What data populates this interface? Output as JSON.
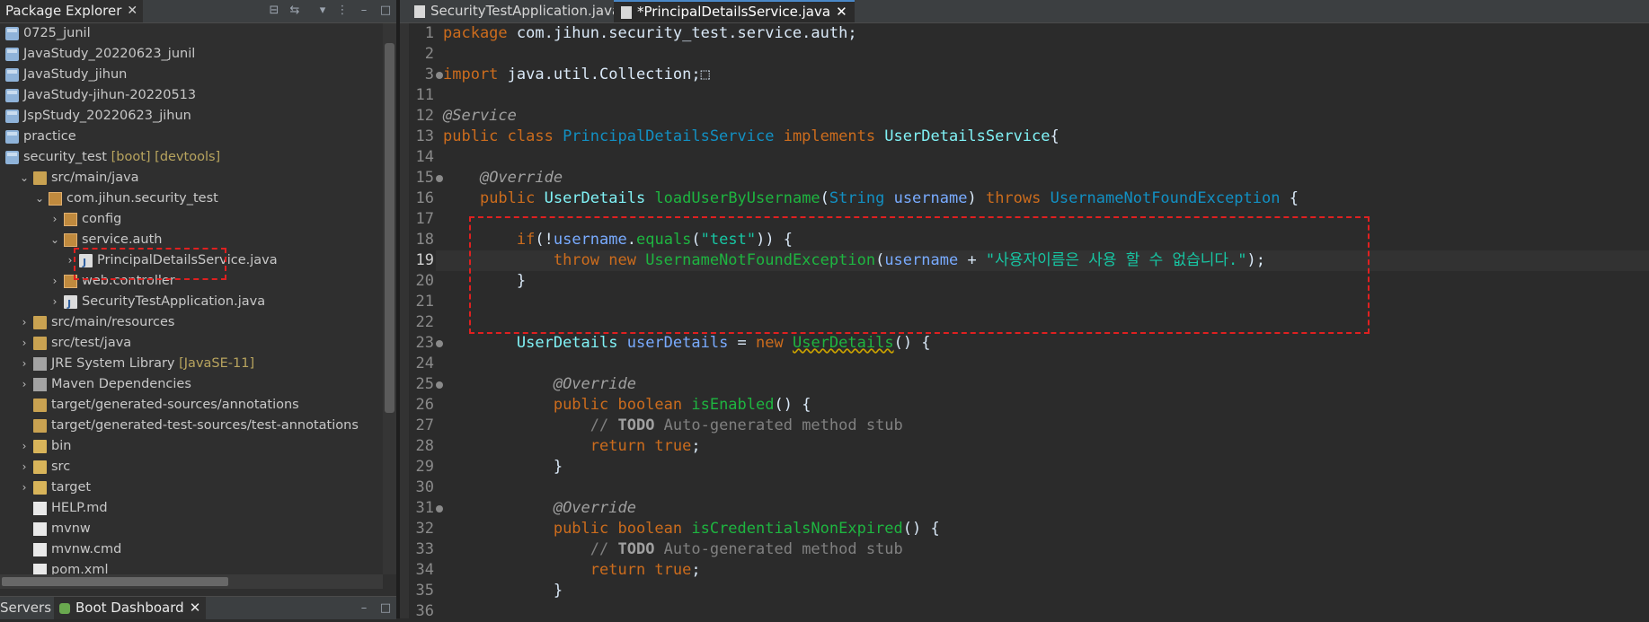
{
  "package_explorer": {
    "title": "Package Explorer",
    "close_glyph": "✕",
    "toolbar_icons": [
      "collapse-all-icon",
      "link-with-editor-icon",
      "filter-icon",
      "view-menu-icon",
      "minimize-icon",
      "maximize-icon"
    ],
    "tree": [
      {
        "label": "0725_junil",
        "icon": "project-icon",
        "depth": 0,
        "twisty": ""
      },
      {
        "label": "JavaStudy_20220623_junil",
        "icon": "project-icon",
        "depth": 0,
        "twisty": ""
      },
      {
        "label": "JavaStudy_jihun",
        "icon": "project-icon",
        "depth": 0,
        "twisty": ""
      },
      {
        "label": "JavaStudy-jihun-20220513",
        "icon": "project-icon",
        "depth": 0,
        "twisty": ""
      },
      {
        "label": "JspStudy_20220623_jihun",
        "icon": "project-icon",
        "depth": 0,
        "twisty": ""
      },
      {
        "label": "practice",
        "icon": "project-icon",
        "depth": 0,
        "twisty": ""
      },
      {
        "label": "security_test",
        "decoration": "[boot] [devtools]",
        "icon": "boot-project-icon",
        "depth": 0,
        "twisty": ""
      },
      {
        "label": "src/main/java",
        "icon": "source-folder-icon",
        "depth": 1,
        "twisty": "v"
      },
      {
        "label": "com.jihun.security_test",
        "icon": "package-icon",
        "depth": 2,
        "twisty": "v"
      },
      {
        "label": "config",
        "icon": "package-icon",
        "depth": 3,
        "twisty": ">"
      },
      {
        "label": "service.auth",
        "icon": "package-icon",
        "depth": 3,
        "twisty": "v"
      },
      {
        "label": "PrincipalDetailsService.java",
        "icon": "java-file-icon",
        "depth": 4,
        "twisty": ">"
      },
      {
        "label": "web.controller",
        "icon": "package-icon",
        "depth": 3,
        "twisty": ">"
      },
      {
        "label": "SecurityTestApplication.java",
        "icon": "java-file-icon",
        "depth": 3,
        "twisty": ">"
      },
      {
        "label": "src/main/resources",
        "icon": "source-folder-icon",
        "depth": 1,
        "twisty": ">"
      },
      {
        "label": "src/test/java",
        "icon": "source-folder-icon",
        "depth": 1,
        "twisty": ">"
      },
      {
        "label": "JRE System Library",
        "decoration": "[JavaSE-11]",
        "icon": "library-icon",
        "depth": 1,
        "twisty": ">"
      },
      {
        "label": "Maven Dependencies",
        "icon": "library-icon",
        "depth": 1,
        "twisty": ">"
      },
      {
        "label": "target/generated-sources/annotations",
        "icon": "source-folder-icon",
        "depth": 1,
        "twisty": ""
      },
      {
        "label": "target/generated-test-sources/test-annotations",
        "icon": "source-folder-icon",
        "depth": 1,
        "twisty": ""
      },
      {
        "label": "bin",
        "icon": "folder-icon",
        "depth": 1,
        "twisty": ">"
      },
      {
        "label": "src",
        "icon": "folder-icon",
        "depth": 1,
        "twisty": ">"
      },
      {
        "label": "target",
        "icon": "folder-icon",
        "depth": 1,
        "twisty": ">"
      },
      {
        "label": "HELP.md",
        "icon": "file-icon",
        "depth": 1,
        "twisty": ""
      },
      {
        "label": "mvnw",
        "icon": "file-icon",
        "depth": 1,
        "twisty": ""
      },
      {
        "label": "mvnw.cmd",
        "icon": "file-icon",
        "depth": 1,
        "twisty": ""
      },
      {
        "label": "pom.xml",
        "icon": "file-icon",
        "depth": 1,
        "twisty": ""
      }
    ]
  },
  "bottom_panel": {
    "servers_tab": "Servers",
    "boot_dashboard_tab": "Boot Dashboard",
    "close_glyph": "✕"
  },
  "editor": {
    "tabs": [
      {
        "label": "SecurityTestApplication.java",
        "active": false
      },
      {
        "label": "*PrincipalDetailsService.java",
        "active": true
      }
    ],
    "current_line": 19,
    "lines": [
      {
        "n": "1",
        "tokens": [
          [
            "kw",
            "package "
          ],
          [
            "plain",
            "com.jihun.security_test.service.auth;"
          ]
        ]
      },
      {
        "n": "2",
        "tokens": []
      },
      {
        "n": "3",
        "fold": true,
        "tokens": [
          [
            "kw",
            "import "
          ],
          [
            "plain",
            "java.util.Collection;"
          ],
          [
            "plain",
            "⬚"
          ]
        ]
      },
      {
        "n": "11",
        "tokens": []
      },
      {
        "n": "12",
        "tokens": [
          [
            "ann",
            "@Service"
          ]
        ]
      },
      {
        "n": "13",
        "tokens": [
          [
            "kw",
            "public class "
          ],
          [
            "typ",
            "PrincipalDetailsService "
          ],
          [
            "kw",
            "implements "
          ],
          [
            "typ2",
            "UserDetailsService"
          ],
          [
            "plain",
            "{"
          ]
        ]
      },
      {
        "n": "14",
        "tokens": []
      },
      {
        "n": "15",
        "fold": true,
        "tokens": [
          [
            "plain",
            "    "
          ],
          [
            "ann",
            "@Override"
          ]
        ]
      },
      {
        "n": "16",
        "tokens": [
          [
            "plain",
            "    "
          ],
          [
            "kw",
            "public "
          ],
          [
            "typ2",
            "UserDetails "
          ],
          [
            "meth",
            "loadUserByUsername"
          ],
          [
            "plain",
            "("
          ],
          [
            "typ",
            "String "
          ],
          [
            "var",
            "username"
          ],
          [
            "plain",
            ") "
          ],
          [
            "kw",
            "throws "
          ],
          [
            "typ",
            "UsernameNotFoundException "
          ],
          [
            "plain",
            "{"
          ]
        ]
      },
      {
        "n": "17",
        "tokens": []
      },
      {
        "n": "18",
        "tokens": [
          [
            "plain",
            "        "
          ],
          [
            "kw",
            "if"
          ],
          [
            "plain",
            "(!"
          ],
          [
            "var",
            "username"
          ],
          [
            "plain",
            "."
          ],
          [
            "meth",
            "equals"
          ],
          [
            "plain",
            "("
          ],
          [
            "str",
            "\"test\""
          ],
          [
            "plain",
            ")) {"
          ]
        ]
      },
      {
        "n": "19",
        "tokens": [
          [
            "plain",
            "            "
          ],
          [
            "kw",
            "throw new "
          ],
          [
            "meth",
            "UsernameNotFoundException"
          ],
          [
            "plain",
            "("
          ],
          [
            "var",
            "username"
          ],
          [
            "plain",
            " + "
          ],
          [
            "str",
            "\"사용자이름은 사용 할 수 없습니다.\""
          ],
          [
            "plain",
            ");"
          ]
        ]
      },
      {
        "n": "20",
        "tokens": [
          [
            "plain",
            "        }"
          ]
        ]
      },
      {
        "n": "21",
        "tokens": []
      },
      {
        "n": "22",
        "tokens": []
      },
      {
        "n": "23",
        "fold": true,
        "tokens": [
          [
            "plain",
            "        "
          ],
          [
            "typ2",
            "UserDetails "
          ],
          [
            "var",
            "userDetails"
          ],
          [
            "plain",
            " = "
          ],
          [
            "kw",
            "new "
          ],
          [
            "meth warn",
            "UserDetails"
          ],
          [
            "plain",
            "() {"
          ]
        ]
      },
      {
        "n": "24",
        "tokens": []
      },
      {
        "n": "25",
        "fold": true,
        "tokens": [
          [
            "plain",
            "            "
          ],
          [
            "ann",
            "@Override"
          ]
        ]
      },
      {
        "n": "26",
        "tokens": [
          [
            "plain",
            "            "
          ],
          [
            "kw",
            "public boolean "
          ],
          [
            "meth",
            "isEnabled"
          ],
          [
            "plain",
            "() {"
          ]
        ]
      },
      {
        "n": "27",
        "tokens": [
          [
            "plain",
            "                "
          ],
          [
            "cmt",
            "// "
          ],
          [
            "todo",
            "TODO"
          ],
          [
            "cmt",
            " Auto-generated method stub"
          ]
        ]
      },
      {
        "n": "28",
        "tokens": [
          [
            "plain",
            "                "
          ],
          [
            "kw",
            "return true"
          ],
          [
            "plain",
            ";"
          ]
        ]
      },
      {
        "n": "29",
        "tokens": [
          [
            "plain",
            "            }"
          ]
        ]
      },
      {
        "n": "30",
        "tokens": []
      },
      {
        "n": "31",
        "fold": true,
        "tokens": [
          [
            "plain",
            "            "
          ],
          [
            "ann",
            "@Override"
          ]
        ]
      },
      {
        "n": "32",
        "tokens": [
          [
            "plain",
            "            "
          ],
          [
            "kw",
            "public boolean "
          ],
          [
            "meth",
            "isCredentialsNonExpired"
          ],
          [
            "plain",
            "() {"
          ]
        ]
      },
      {
        "n": "33",
        "tokens": [
          [
            "plain",
            "                "
          ],
          [
            "cmt",
            "// "
          ],
          [
            "todo",
            "TODO"
          ],
          [
            "cmt",
            " Auto-generated method stub"
          ]
        ]
      },
      {
        "n": "34",
        "tokens": [
          [
            "plain",
            "                "
          ],
          [
            "kw",
            "return true"
          ],
          [
            "plain",
            ";"
          ]
        ]
      },
      {
        "n": "35",
        "tokens": [
          [
            "plain",
            "            }"
          ]
        ]
      },
      {
        "n": "36",
        "tokens": []
      }
    ]
  },
  "colors": {
    "keyword": "#cc6c1d",
    "string": "#17c6a3",
    "method": "#1eb540",
    "type": "#1290c3",
    "annotation_highlight": "#e02020"
  }
}
